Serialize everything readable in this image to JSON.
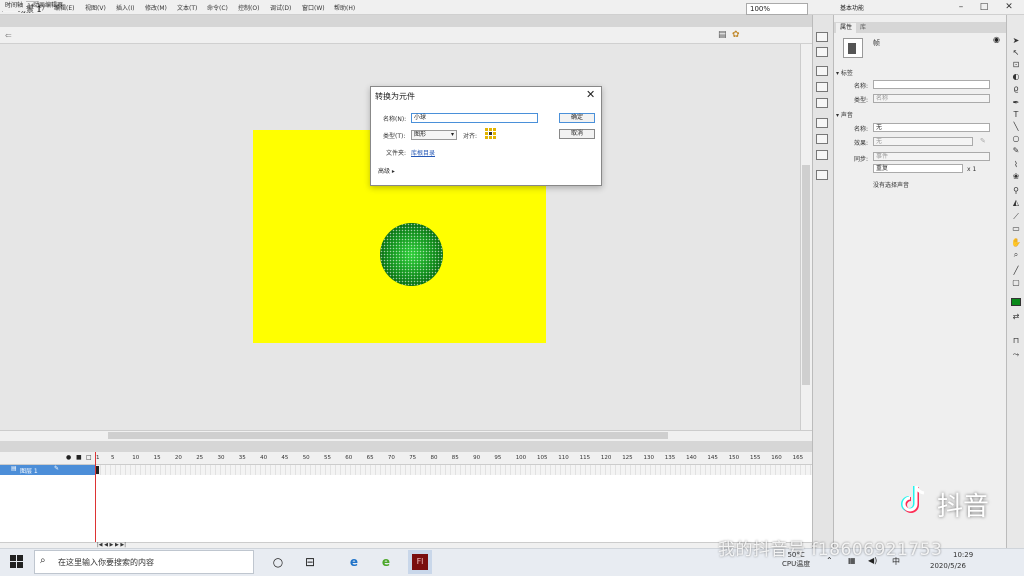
{
  "app": {
    "logo": "Fl",
    "menus": [
      "文件(F)",
      "编辑(E)",
      "视图(V)",
      "插入(I)",
      "修改(M)",
      "文本(T)",
      "命令(C)",
      "控制(O)",
      "调试(D)",
      "窗口(W)",
      "帮助(H)"
    ],
    "workspace": "基本功能",
    "window_buttons": [
      "–",
      "□",
      "✕"
    ]
  },
  "document": {
    "tab": "未命名-1*",
    "scene": "场景 1",
    "zoom": "100%"
  },
  "dialog": {
    "title": "转换为元件",
    "close": "✕",
    "name_label": "名称(N):",
    "name_value": "小球",
    "type_label": "类型(T):",
    "type_value": "图形",
    "align_label": "对齐:",
    "folder_label": "文件夹:",
    "folder_link": "库根目录",
    "advanced": "高级 ▸",
    "ok": "确定",
    "cancel": "取消"
  },
  "timeline": {
    "tabs": [
      "时间轴",
      "动画编辑器"
    ],
    "layer_name": "图层 1",
    "frame_ticks": [
      "1",
      "5",
      "10",
      "15",
      "20",
      "25",
      "30",
      "35",
      "40",
      "45",
      "50",
      "55",
      "60",
      "65",
      "70",
      "75",
      "80",
      "85",
      "90",
      "95",
      "100",
      "105",
      "110",
      "115",
      "120",
      "125",
      "130",
      "135",
      "140",
      "145",
      "150",
      "155",
      "160",
      "165"
    ]
  },
  "properties": {
    "tabs": [
      "属性",
      "库"
    ],
    "symbol_kind": "帧",
    "section_label": "标签",
    "name_label": "名称:",
    "type_label": "类型:",
    "type_value": "名称",
    "section_sound": "声音",
    "sound_name_label": "名称:",
    "sound_name_value": "无",
    "effect_label": "效果:",
    "effect_value": "无",
    "sync_label": "同步:",
    "sync_value": "事件",
    "repeat_value": "重复",
    "repeat_count": "x 1",
    "no_sound": "没有选择声音"
  },
  "taskbar": {
    "search_placeholder": "在这里输入你要搜索的内容",
    "temp": "50°C",
    "cpu": "CPU温度",
    "time": "10:29",
    "date": "2020/5/26"
  },
  "overlay": {
    "watermark": "我的抖音号 f18606921753",
    "douyin": "抖音"
  },
  "colors": {
    "stage": "#ffff00",
    "ball_center": "#2fd13a",
    "ball_edge": "#033b08",
    "layer_selected": "#4c8ed8"
  }
}
